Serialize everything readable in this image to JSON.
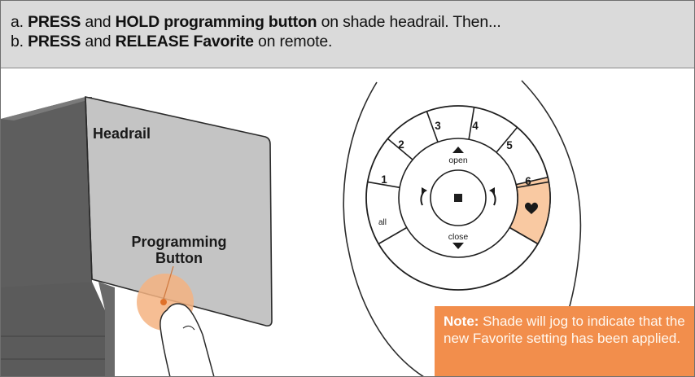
{
  "instructions": {
    "step_a": {
      "prefix": "a. ",
      "b1": "PRESS",
      "t1": " and ",
      "b2": "HOLD programming button",
      "t2": " on shade headrail.  Then..."
    },
    "step_b": {
      "prefix": "b. ",
      "b1": "PRESS",
      "t1": " and ",
      "b2": "RELEASE Favorite",
      "t2": " on remote."
    }
  },
  "headrail": {
    "label": "Headrail",
    "button_label_line1": "Programming",
    "button_label_line2": "Button"
  },
  "remote": {
    "channels": [
      "1",
      "2",
      "3",
      "4",
      "5",
      "6"
    ],
    "all_label": "all",
    "open_label": "open",
    "close_label": "close",
    "stop_symbol": "■",
    "favorite_symbol": "❤"
  },
  "note": {
    "label": "Note:",
    "text": " Shade will jog to indicate that the new Favorite setting has been applied."
  },
  "colors": {
    "accent_orange": "#f28e4c",
    "favorite_highlight": "#f9c9a2",
    "header_gray": "#dadada",
    "headrail_face": "#c4c4c4"
  }
}
